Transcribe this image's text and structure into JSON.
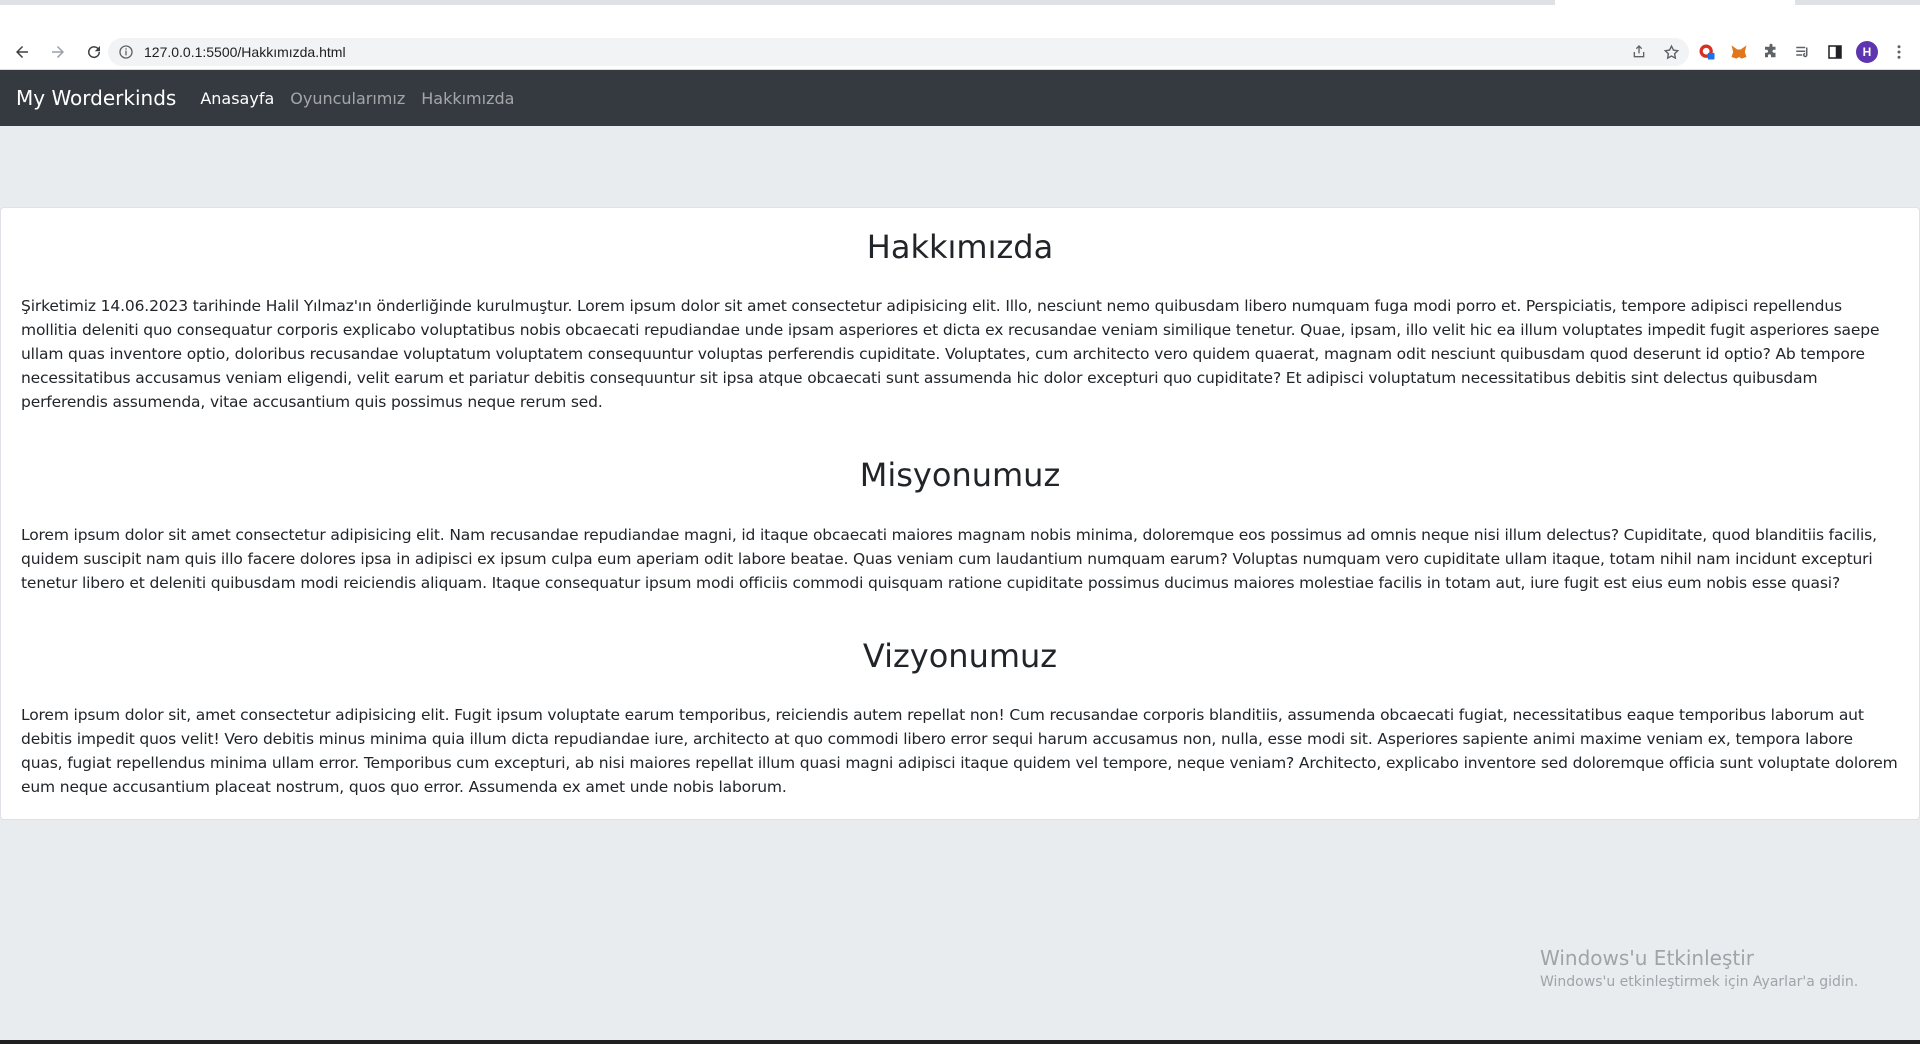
{
  "browser": {
    "url": "127.0.0.1:5500/Hakkımızda.html",
    "profile_initial": "H"
  },
  "navbar": {
    "brand": "My Worderkinds",
    "links": [
      "Anasayfa",
      "Oyuncularımız",
      "Hakkımızda"
    ]
  },
  "sections": [
    {
      "title": "Hakkımızda",
      "text": "Şirketimiz 14.06.2023 tarihinde Halil Yılmaz'ın önderliğinde kurulmuştur. Lorem ipsum dolor sit amet consectetur adipisicing elit. Illo, nesciunt nemo quibusdam libero numquam fuga modi porro et. Perspiciatis, tempore adipisci repellendus mollitia deleniti quo consequatur corporis explicabo voluptatibus nobis obcaecati repudiandae unde ipsam asperiores et dicta ex recusandae veniam similique tenetur. Quae, ipsam, illo velit hic ea illum voluptates impedit fugit asperiores saepe ullam quas inventore optio, doloribus recusandae voluptatum voluptatem consequuntur voluptas perferendis cupiditate. Voluptates, cum architecto vero quidem quaerat, magnam odit nesciunt quibusdam quod deserunt id optio? Ab tempore necessitatibus accusamus veniam eligendi, velit earum et pariatur debitis consequuntur sit ipsa atque obcaecati sunt assumenda hic dolor excepturi quo cupiditate? Et adipisci voluptatum necessitatibus debitis sint delectus quibusdam perferendis assumenda, vitae accusantium quis possimus neque rerum sed."
    },
    {
      "title": "Misyonumuz",
      "text": "Lorem ipsum dolor sit amet consectetur adipisicing elit. Nam recusandae repudiandae magni, id itaque obcaecati maiores magnam nobis minima, doloremque eos possimus ad omnis neque nisi illum delectus? Cupiditate, quod blanditiis facilis, quidem suscipit nam quis illo facere dolores ipsa in adipisci ex ipsum culpa eum aperiam odit labore beatae. Quas veniam cum laudantium numquam earum? Voluptas numquam vero cupiditate ullam itaque, totam nihil nam incidunt excepturi tenetur libero et deleniti quibusdam modi reiciendis aliquam. Itaque consequatur ipsum modi officiis commodi quisquam ratione cupiditate possimus ducimus maiores molestiae facilis in totam aut, iure fugit est eius eum nobis esse quasi?"
    },
    {
      "title": "Vizyonumuz",
      "text": "Lorem ipsum dolor sit, amet consectetur adipisicing elit. Fugit ipsum voluptate earum temporibus, reiciendis autem repellat non! Cum recusandae corporis blanditiis, assumenda obcaecati fugiat, necessitatibus eaque temporibus laborum aut debitis impedit quos velit! Vero debitis minus minima quia illum dicta repudiandae iure, architecto at quo commodi libero error sequi harum accusamus non, nulla, esse modi sit. Asperiores sapiente animi maxime veniam ex, tempora labore quas, fugiat repellendus minima ullam error. Temporibus cum excepturi, ab nisi maiores repellat illum quasi magni adipisci itaque quidem vel tempore, neque veniam? Architecto, explicabo inventore sed doloremque officia sunt voluptate dolorem eum neque accusantium placeat nostrum, quos quo error. Assumenda ex amet unde nobis laborum."
    }
  ],
  "watermark": {
    "line1": "Windows'u Etkinleştir",
    "line2": "Windows'u etkinleştirmek için Ayarlar'a gidin."
  },
  "colors": {
    "navbar_bg": "#343a40",
    "page_bg": "#e9ecef",
    "profile_bg": "#5e35b1"
  }
}
